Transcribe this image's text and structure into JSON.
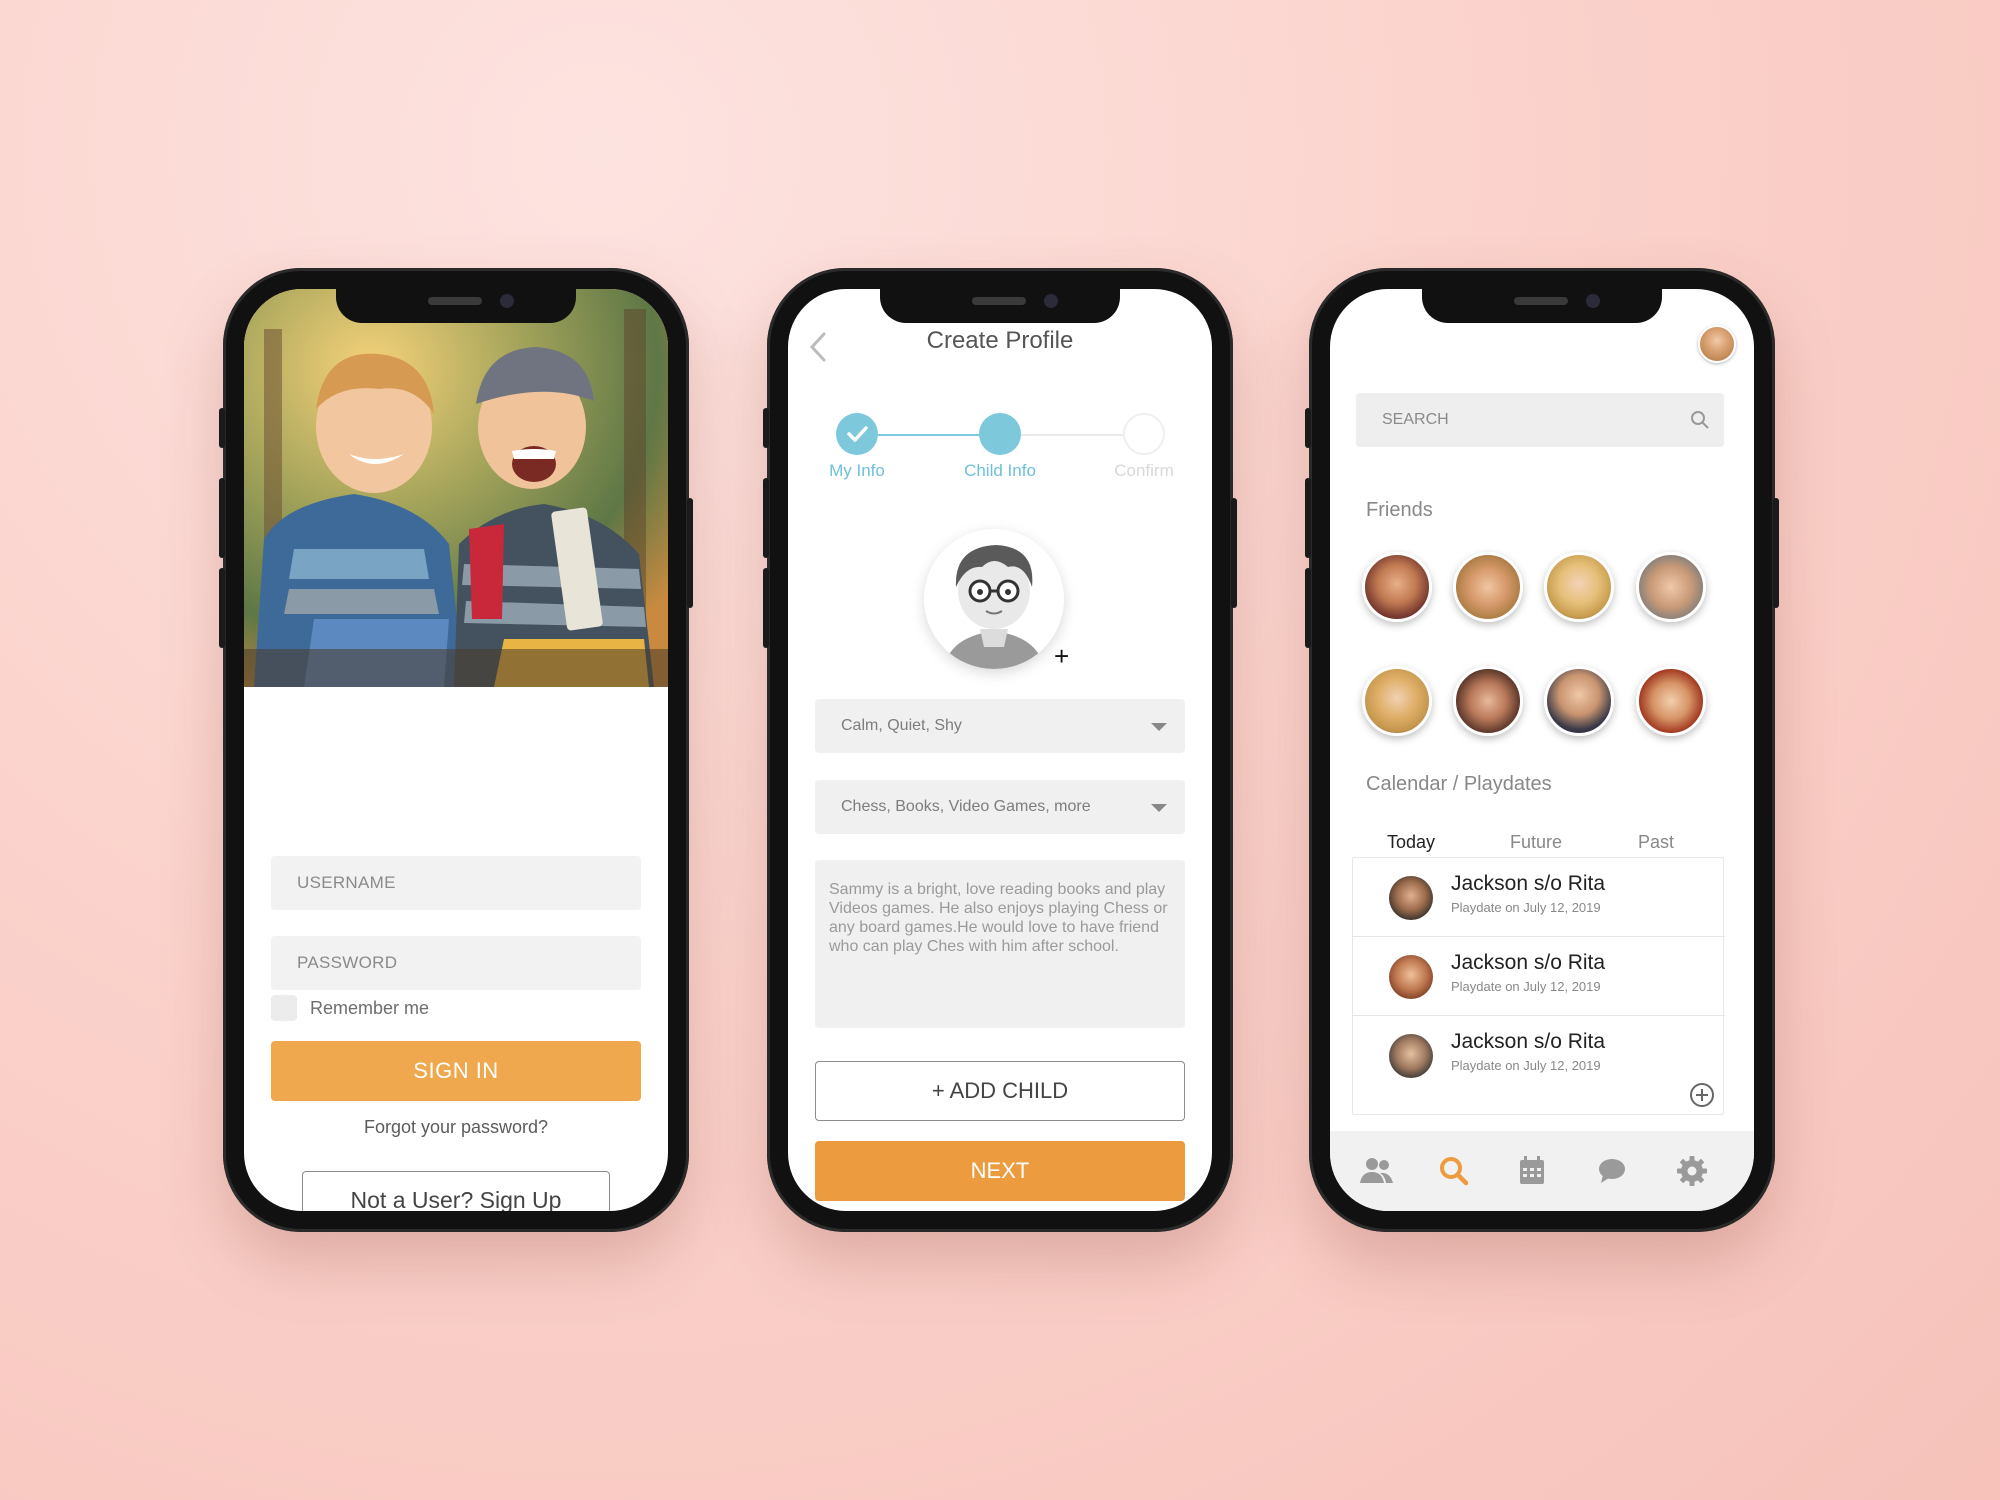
{
  "colors": {
    "accent_orange": "#efa84d",
    "step_blue": "#7ec8dc",
    "nav_active": "#ec9b3e",
    "nav_inactive": "#9a9a9a"
  },
  "login": {
    "hero_icon": "children-photo",
    "username_placeholder": "USERNAME",
    "password_placeholder": "PASSWORD",
    "remember_label": "Remember me",
    "signin_label": "SIGN IN",
    "forgot_label": "Forgot your password?",
    "signup_label": "Not a User? Sign Up"
  },
  "create_profile": {
    "title": "Create Profile",
    "steps": [
      {
        "label": "My Info",
        "state": "done"
      },
      {
        "label": "Child Info",
        "state": "active"
      },
      {
        "label": "Confirm",
        "state": "pending"
      }
    ],
    "avatar_plus": "+",
    "personality_value": "Calm, Quiet, Shy",
    "interests_value": "Chess, Books, Video Games, more",
    "bio": "Sammy is a bright, love reading books and play Videos games. He also enjoys playing Chess or any board games.He would love to have friend who can play Ches with him after school.",
    "add_child_label": "+ ADD CHILD",
    "next_label": "NEXT"
  },
  "friends_screen": {
    "search_placeholder": "SEARCH",
    "friends_title": "Friends",
    "calendar_title": "Calendar / Playdates",
    "tabs": [
      "Today",
      "Future",
      "Past"
    ],
    "active_tab": "Today",
    "playdates": [
      {
        "name": "Jackson s/o Rita",
        "sub": "Playdate on July 12, 2019"
      },
      {
        "name": "Jackson s/o Rita",
        "sub": "Playdate on July 12, 2019"
      },
      {
        "name": "Jackson s/o Rita",
        "sub": "Playdate on July 12, 2019"
      }
    ],
    "nav": [
      "people-icon",
      "search-icon",
      "calendar-icon",
      "chat-icon",
      "gear-icon"
    ],
    "active_nav": "search-icon"
  }
}
